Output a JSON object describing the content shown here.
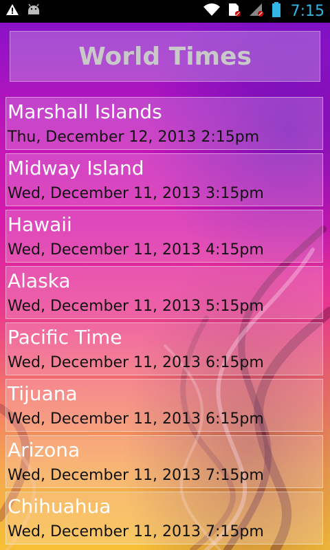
{
  "status_bar": {
    "time": "7:15",
    "left_icons": [
      "warning-icon",
      "android-icon"
    ],
    "right_icons": [
      "wifi-icon",
      "sim-icon",
      "signal-icon",
      "battery-icon"
    ],
    "accent_color": "#33b5e5"
  },
  "header": {
    "title": "World Times"
  },
  "zones": [
    {
      "name": "Marshall Islands",
      "time": "Thu, December 12, 2013 2:15pm"
    },
    {
      "name": "Midway Island",
      "time": "Wed, December 11, 2013 3:15pm"
    },
    {
      "name": "Hawaii",
      "time": "Wed, December 11, 2013 4:15pm"
    },
    {
      "name": "Alaska",
      "time": "Wed, December 11, 2013 5:15pm"
    },
    {
      "name": "Pacific Time",
      "time": "Wed, December 11, 2013 6:15pm"
    },
    {
      "name": "Tijuana",
      "time": "Wed, December 11, 2013 6:15pm"
    },
    {
      "name": "Arizona",
      "time": "Wed, December 11, 2013 7:15pm"
    },
    {
      "name": "Chihuahua",
      "time": "Wed, December 11, 2013 7:15pm"
    }
  ]
}
